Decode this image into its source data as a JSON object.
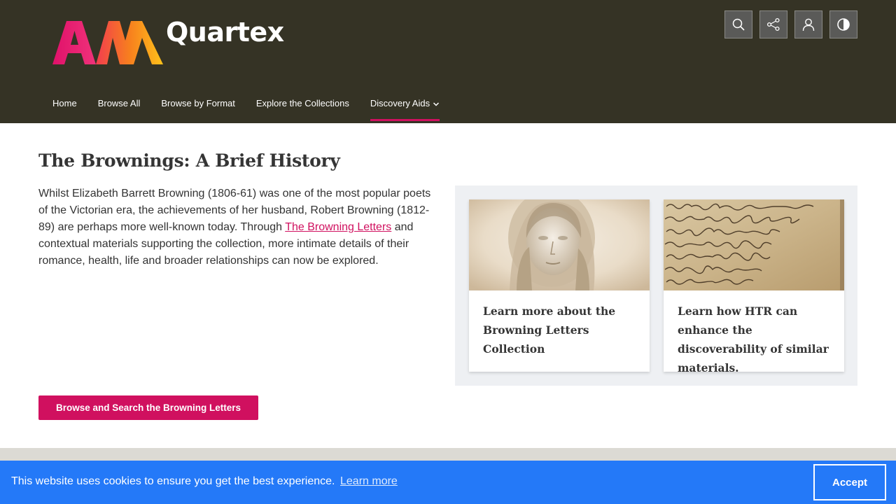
{
  "brand": {
    "name": "Quartex",
    "logo_icon": "am-logo",
    "colors": {
      "header_bg": "#353325",
      "accent": "#d0105f",
      "cookie_bg": "#2479f8"
    }
  },
  "tools": [
    {
      "name": "search-icon",
      "label": "Search"
    },
    {
      "name": "share-icon",
      "label": "Share"
    },
    {
      "name": "user-icon",
      "label": "Account"
    },
    {
      "name": "contrast-icon",
      "label": "Contrast"
    }
  ],
  "nav": {
    "items": [
      {
        "label": "Home"
      },
      {
        "label": "Browse All"
      },
      {
        "label": "Browse by Format"
      },
      {
        "label": "Explore the Collections"
      },
      {
        "label": "Discovery Aids",
        "active": true,
        "icon": "chevron-down-icon"
      }
    ]
  },
  "main": {
    "title": "The Brownings: A Brief History",
    "intro_before": "Whilst Elizabeth Barrett Browning (1806-61) was one of the most popular poets of the Victorian era, the achievements of her husband, Robert Browning (1812-89) are perhaps more well-known today. Through ",
    "intro_link": "The Browning Letters",
    "intro_after": " and contextual materials supporting the collection, more intimate details of their romance, health, life and broader relationships can now be explored.",
    "cards": [
      {
        "text": "Learn more about the Browning Letters Collection",
        "image": "portrait-bust"
      },
      {
        "text": "Learn how HTR can enhance the discoverability of similar materials.",
        "image": "handwritten-letter"
      }
    ],
    "browse_button": "Browse and Search the Browning Letters"
  },
  "cookie": {
    "message": "This website uses cookies to ensure you get the best experience.",
    "link": "Learn more",
    "accept": "Accept"
  }
}
